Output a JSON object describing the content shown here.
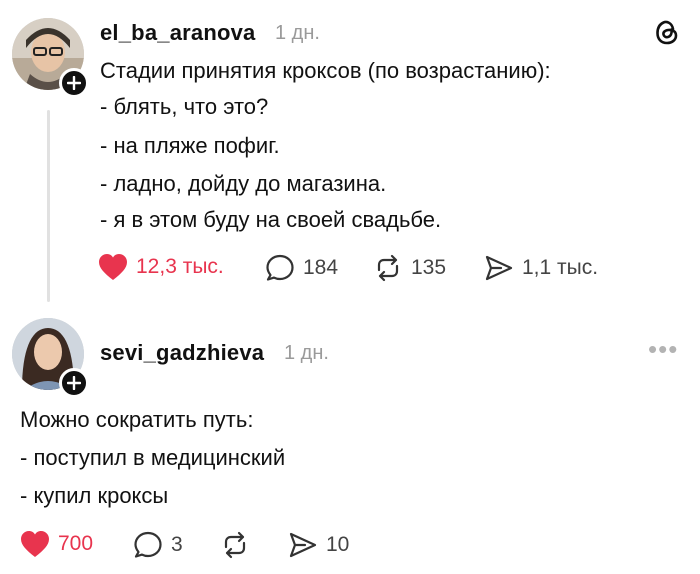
{
  "post1": {
    "username": "el_ba_aranova",
    "time": "1 дн.",
    "lines": [
      "Стадии принятия кроксов (по возрастанию):",
      "- блять, что это?",
      "- на пляже пофиг.",
      "- ладно, дойду до магазина.",
      "- я в этом буду на своей свадьбе."
    ],
    "likes": "12,3 тыс.",
    "replies": "184",
    "reposts": "135",
    "shares": "1,1 тыс."
  },
  "post2": {
    "username": "sevi_gadzhieva",
    "time": "1 дн.",
    "lines": [
      "Можно сократить путь:",
      "- поступил в медицинский",
      "- купил кроксы"
    ],
    "likes": "700",
    "replies": "3",
    "shares": "10"
  },
  "colors": {
    "like": "#e8344e",
    "muted": "#9a9a9a",
    "thread_line": "#e1e1e1"
  },
  "icons": [
    "threads-logo-icon",
    "heart-icon",
    "comment-icon",
    "repost-icon",
    "share-icon",
    "more-icon",
    "follow-plus-icon"
  ]
}
